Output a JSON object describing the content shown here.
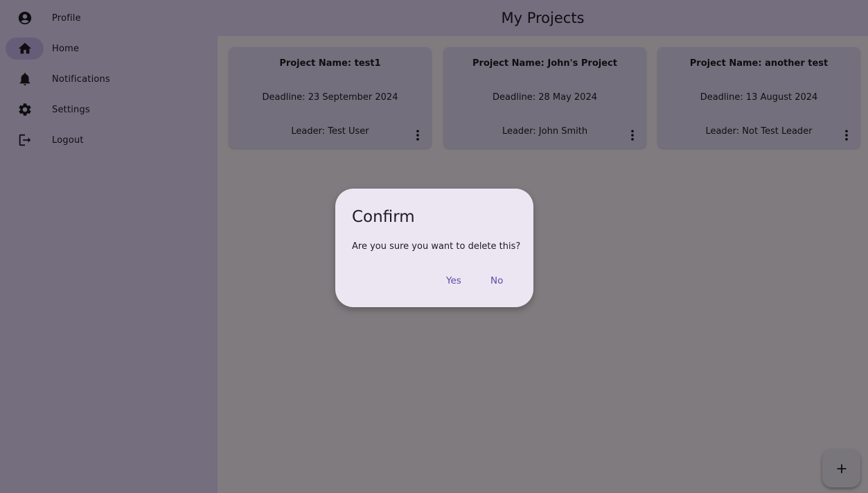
{
  "header": {
    "title": "My Projects"
  },
  "sidebar": {
    "items": [
      {
        "label": "Profile",
        "icon": "account-circle-icon",
        "active": false
      },
      {
        "label": "Home",
        "icon": "home-icon",
        "active": true
      },
      {
        "label": "Notifications",
        "icon": "bell-icon",
        "active": false
      },
      {
        "label": "Settings",
        "icon": "gear-icon",
        "active": false
      },
      {
        "label": "Logout",
        "icon": "logout-icon",
        "active": false
      }
    ]
  },
  "projects": [
    {
      "name": "Project Name: test1",
      "deadline": "Deadline: 23 September 2024",
      "leader": "Leader: Test User"
    },
    {
      "name": "Project Name: John's Project",
      "deadline": "Deadline: 28 May 2024",
      "leader": "Leader: John Smith"
    },
    {
      "name": "Project Name: another test",
      "deadline": "Deadline: 13 August 2024",
      "leader": "Leader: Not Test Leader"
    }
  ],
  "fab": {
    "icon": "plus-icon"
  },
  "dialog": {
    "title": "Confirm",
    "message": "Are you sure you want to delete this?",
    "yes_label": "Yes",
    "no_label": "No"
  },
  "colors": {
    "sidebar_bg": "#e9ddff",
    "card_bg": "#e8def8",
    "active_indicator": "#cdbdf2",
    "dialog_bg": "#ece6f2",
    "dialog_button_text": "#5d49a8"
  }
}
